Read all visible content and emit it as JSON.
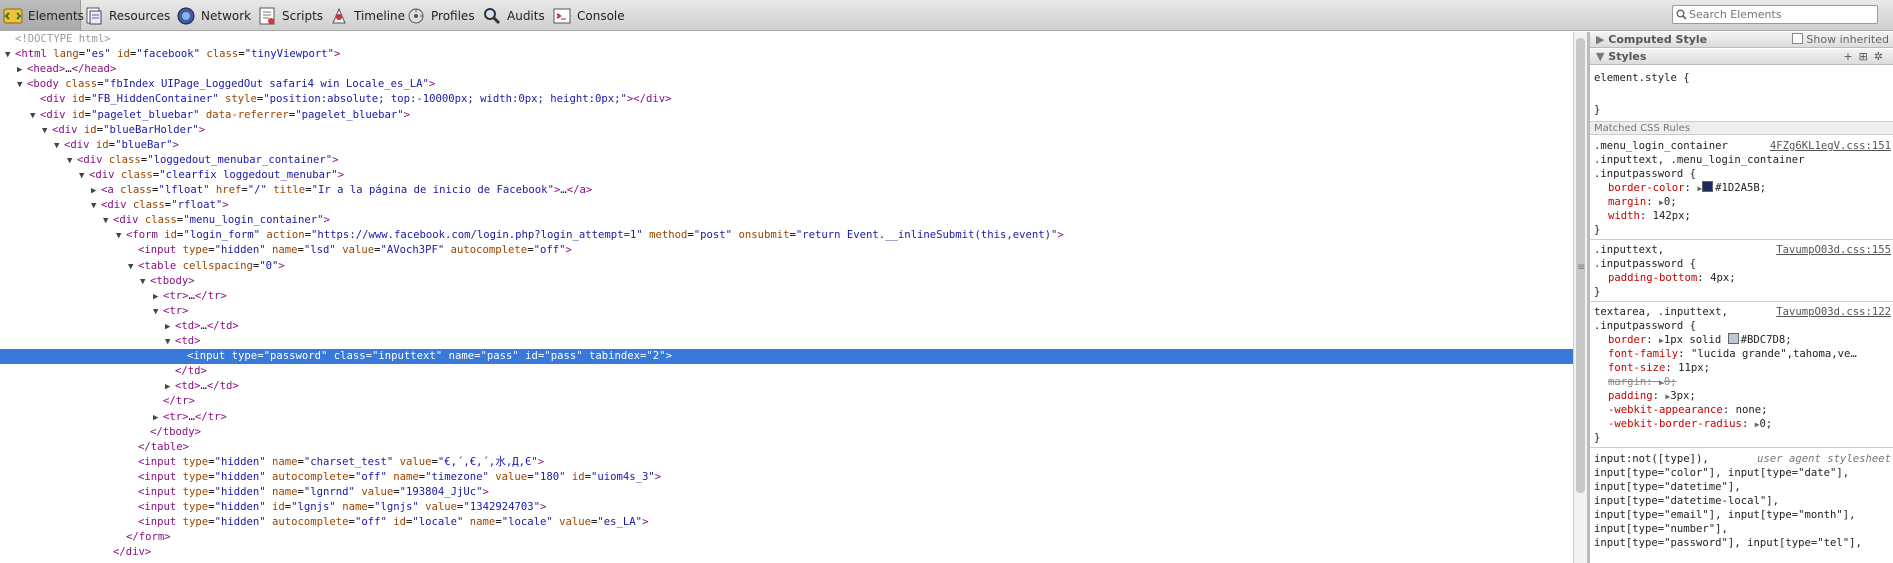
{
  "toolbar": {
    "tabs": [
      {
        "label": "Elements",
        "icon": "elements-icon"
      },
      {
        "label": "Resources",
        "icon": "resources-icon"
      },
      {
        "label": "Network",
        "icon": "network-icon"
      },
      {
        "label": "Scripts",
        "icon": "scripts-icon"
      },
      {
        "label": "Timeline",
        "icon": "timeline-icon"
      },
      {
        "label": "Profiles",
        "icon": "profiles-icon"
      },
      {
        "label": "Audits",
        "icon": "audits-icon"
      },
      {
        "label": "Console",
        "icon": "console-icon"
      }
    ],
    "search_placeholder": "Search Elements"
  },
  "dom": {
    "lines": [
      {
        "depth": 0,
        "tri": "",
        "html": "<span class=\"cm\">&lt;!DOCTYPE html&gt;</span>"
      },
      {
        "depth": 0,
        "tri": "▼",
        "html": "<span class=\"tag\">&lt;html</span> <span class=\"an\">lang</span>=<span class=\"av\">\"es\"</span> <span class=\"an\">id</span>=<span class=\"av\">\"facebook\"</span> <span class=\"an\">class</span>=<span class=\"av\">\"tinyViewport\"</span><span class=\"tag\">&gt;</span>"
      },
      {
        "depth": 1,
        "tri": "▶",
        "html": "<span class=\"tag\">&lt;head&gt;</span><span class=\"tx\">…</span><span class=\"tag\">&lt;/head&gt;</span>"
      },
      {
        "depth": 1,
        "tri": "▼",
        "html": "<span class=\"tag\">&lt;body</span> <span class=\"an\">class</span>=<span class=\"av\">\"fbIndex UIPage_LoggedOut safari4 win Locale_es_LA\"</span><span class=\"tag\">&gt;</span>"
      },
      {
        "depth": 2,
        "tri": "",
        "html": "<span class=\"tag\">&lt;div</span> <span class=\"an\">id</span>=<span class=\"av\">\"FB_HiddenContainer\"</span> <span class=\"an\">style</span>=<span class=\"av\">\"position:absolute; top:-10000px; width:0px; height:0px;\"</span><span class=\"tag\">&gt;&lt;/div&gt;</span>"
      },
      {
        "depth": 2,
        "tri": "▼",
        "html": "<span class=\"tag\">&lt;div</span> <span class=\"an\">id</span>=<span class=\"av\">\"pagelet_bluebar\"</span> <span class=\"an\">data-referrer</span>=<span class=\"av\">\"pagelet_bluebar\"</span><span class=\"tag\">&gt;</span>"
      },
      {
        "depth": 3,
        "tri": "▼",
        "html": "<span class=\"tag\">&lt;div</span> <span class=\"an\">id</span>=<span class=\"av\">\"blueBarHolder\"</span><span class=\"tag\">&gt;</span>"
      },
      {
        "depth": 4,
        "tri": "▼",
        "html": "<span class=\"tag\">&lt;div</span> <span class=\"an\">id</span>=<span class=\"av\">\"blueBar\"</span><span class=\"tag\">&gt;</span>"
      },
      {
        "depth": 5,
        "tri": "▼",
        "html": "<span class=\"tag\">&lt;div</span> <span class=\"an\">class</span>=<span class=\"av\">\"loggedout_menubar_container\"</span><span class=\"tag\">&gt;</span>"
      },
      {
        "depth": 6,
        "tri": "▼",
        "html": "<span class=\"tag\">&lt;div</span> <span class=\"an\">class</span>=<span class=\"av\">\"clearfix loggedout_menubar\"</span><span class=\"tag\">&gt;</span>"
      },
      {
        "depth": 7,
        "tri": "▶",
        "html": "<span class=\"tag\">&lt;a</span> <span class=\"an\">class</span>=<span class=\"av\">\"lfloat\"</span> <span class=\"an\">href</span>=<span class=\"av\">\"/\"</span> <span class=\"an\">title</span>=<span class=\"av\">\"Ir a la página de inicio de Facebook\"</span><span class=\"tag\">&gt;</span><span class=\"tx\">…</span><span class=\"tag\">&lt;/a&gt;</span>"
      },
      {
        "depth": 7,
        "tri": "▼",
        "html": "<span class=\"tag\">&lt;div</span> <span class=\"an\">class</span>=<span class=\"av\">\"rfloat\"</span><span class=\"tag\">&gt;</span>"
      },
      {
        "depth": 8,
        "tri": "▼",
        "html": "<span class=\"tag\">&lt;div</span> <span class=\"an\">class</span>=<span class=\"av\">\"menu_login_container\"</span><span class=\"tag\">&gt;</span>"
      },
      {
        "depth": 9,
        "tri": "▼",
        "html": "<span class=\"tag\">&lt;form</span> <span class=\"an\">id</span>=<span class=\"av\">\"login_form\"</span> <span class=\"an\">action</span>=<span class=\"av\">\"https://www.facebook.com/login.php?login_attempt=1\"</span> <span class=\"an\">method</span>=<span class=\"av\">\"post\"</span> <span class=\"an\">onsubmit</span>=<span class=\"av\">\"return Event.__inlineSubmit(this,event)\"</span><span class=\"tag\">&gt;</span>"
      },
      {
        "depth": 10,
        "tri": "",
        "html": "<span class=\"tag\">&lt;input</span> <span class=\"an\">type</span>=<span class=\"av\">\"hidden\"</span> <span class=\"an\">name</span>=<span class=\"av\">\"lsd\"</span> <span class=\"an\">value</span>=<span class=\"av\">\"AVoch3PF\"</span> <span class=\"an\">autocomplete</span>=<span class=\"av\">\"off\"</span><span class=\"tag\">&gt;</span>"
      },
      {
        "depth": 10,
        "tri": "▼",
        "html": "<span class=\"tag\">&lt;table</span> <span class=\"an\">cellspacing</span>=<span class=\"av\">\"0\"</span><span class=\"tag\">&gt;</span>"
      },
      {
        "depth": 11,
        "tri": "▼",
        "html": "<span class=\"tag\">&lt;tbody&gt;</span>"
      },
      {
        "depth": 12,
        "tri": "▶",
        "html": "<span class=\"tag\">&lt;tr&gt;</span><span class=\"tx\">…</span><span class=\"tag\">&lt;/tr&gt;</span>"
      },
      {
        "depth": 12,
        "tri": "▼",
        "html": "<span class=\"tag\">&lt;tr&gt;</span>"
      },
      {
        "depth": 13,
        "tri": "▶",
        "html": "<span class=\"tag\">&lt;td&gt;</span><span class=\"tx\">…</span><span class=\"tag\">&lt;/td&gt;</span>"
      },
      {
        "depth": 13,
        "tri": "▼",
        "html": "<span class=\"tag\">&lt;td&gt;</span>"
      },
      {
        "depth": 14,
        "tri": "",
        "sel": true,
        "html": "<span class=\"tag\">&lt;input</span> <span class=\"an\">type</span>=<span class=\"av\">\"password\"</span> <span class=\"an\">class</span>=<span class=\"av\">\"inputtext\"</span> <span class=\"an\">name</span>=<span class=\"av\">\"pass\"</span> <span class=\"an\">id</span>=<span class=\"av\">\"pass\"</span> <span class=\"an\">tabindex</span>=<span class=\"av\">\"2\"</span><span class=\"tag\">&gt;</span>"
      },
      {
        "depth": 13,
        "tri": "",
        "html": "<span class=\"tag\">&lt;/td&gt;</span>"
      },
      {
        "depth": 13,
        "tri": "▶",
        "html": "<span class=\"tag\">&lt;td&gt;</span><span class=\"tx\">…</span><span class=\"tag\">&lt;/td&gt;</span>"
      },
      {
        "depth": 12,
        "tri": "",
        "html": "<span class=\"tag\">&lt;/tr&gt;</span>"
      },
      {
        "depth": 12,
        "tri": "▶",
        "html": "<span class=\"tag\">&lt;tr&gt;</span><span class=\"tx\">…</span><span class=\"tag\">&lt;/tr&gt;</span>"
      },
      {
        "depth": 11,
        "tri": "",
        "html": "<span class=\"tag\">&lt;/tbody&gt;</span>"
      },
      {
        "depth": 10,
        "tri": "",
        "html": "<span class=\"tag\">&lt;/table&gt;</span>"
      },
      {
        "depth": 10,
        "tri": "",
        "html": "<span class=\"tag\">&lt;input</span> <span class=\"an\">type</span>=<span class=\"av\">\"hidden\"</span> <span class=\"an\">name</span>=<span class=\"av\">\"charset_test\"</span> <span class=\"an\">value</span>=<span class=\"av\">\"€,´,€,´,水,Д,Є\"</span><span class=\"tag\">&gt;</span>"
      },
      {
        "depth": 10,
        "tri": "",
        "html": "<span class=\"tag\">&lt;input</span> <span class=\"an\">type</span>=<span class=\"av\">\"hidden\"</span> <span class=\"an\">autocomplete</span>=<span class=\"av\">\"off\"</span> <span class=\"an\">name</span>=<span class=\"av\">\"timezone\"</span> <span class=\"an\">value</span>=<span class=\"av\">\"180\"</span> <span class=\"an\">id</span>=<span class=\"av\">\"uiom4s_3\"</span><span class=\"tag\">&gt;</span>"
      },
      {
        "depth": 10,
        "tri": "",
        "html": "<span class=\"tag\">&lt;input</span> <span class=\"an\">type</span>=<span class=\"av\">\"hidden\"</span> <span class=\"an\">name</span>=<span class=\"av\">\"lgnrnd\"</span> <span class=\"an\">value</span>=<span class=\"av\">\"193804_JjUc\"</span><span class=\"tag\">&gt;</span>"
      },
      {
        "depth": 10,
        "tri": "",
        "html": "<span class=\"tag\">&lt;input</span> <span class=\"an\">type</span>=<span class=\"av\">\"hidden\"</span> <span class=\"an\">id</span>=<span class=\"av\">\"lgnjs\"</span> <span class=\"an\">name</span>=<span class=\"av\">\"lgnjs\"</span> <span class=\"an\">value</span>=<span class=\"av\">\"1342924703\"</span><span class=\"tag\">&gt;</span>"
      },
      {
        "depth": 10,
        "tri": "",
        "html": "<span class=\"tag\">&lt;input</span> <span class=\"an\">type</span>=<span class=\"av\">\"hidden\"</span> <span class=\"an\">autocomplete</span>=<span class=\"av\">\"off\"</span> <span class=\"an\">id</span>=<span class=\"av\">\"locale\"</span> <span class=\"an\">name</span>=<span class=\"av\">\"locale\"</span> <span class=\"an\">value</span>=<span class=\"av\">\"es_LA\"</span><span class=\"tag\">&gt;</span>"
      },
      {
        "depth": 9,
        "tri": "",
        "html": "<span class=\"tag\">&lt;/form&gt;</span>"
      },
      {
        "depth": 8,
        "tri": "",
        "html": "<span class=\"tag\">&lt;/div&gt;</span>"
      }
    ]
  },
  "sidebar": {
    "computed_style": "Computed Style",
    "show_inherited": "Show inherited",
    "styles": "Styles",
    "element_style_open": "element.style {",
    "close_brace": "}",
    "matched_css_rules": "Matched CSS Rules",
    "rule1": {
      "sel1": ".menu_login_container",
      "sel2": ".inputtext, .menu_login_container",
      "sel3": ".inputpassword {",
      "source": "4FZg6KL1egV.css:151",
      "props": [
        {
          "name": "border-color",
          "value": "#1D2A5B;",
          "swatch": "#1D2A5B",
          "arrow": true
        },
        {
          "name": "margin",
          "value": "0;",
          "arrow": true
        },
        {
          "name": "width",
          "value": "142px;"
        }
      ]
    },
    "rule2": {
      "sel1": ".inputtext,",
      "sel2": ".inputpassword {",
      "source": "TavumpO03d.css:155",
      "props": [
        {
          "name": "padding-bottom",
          "value": "4px;"
        }
      ]
    },
    "rule3": {
      "sel1": "textarea, .inputtext,",
      "sel2": ".inputpassword {",
      "source": "TavumpO03d.css:122",
      "props": [
        {
          "name": "border",
          "value": "1px solid ",
          "swatch": "#BDC7D8",
          "value2": "#BDC7D8;",
          "arrow": true
        },
        {
          "name": "font-family",
          "value": "\"lucida grande\",tahoma,ve…"
        },
        {
          "name": "font-size",
          "value": "11px;"
        },
        {
          "name": "margin",
          "value": "0;",
          "arrow": true,
          "struck": true
        },
        {
          "name": "padding",
          "value": "3px;",
          "arrow": true
        },
        {
          "name": "-webkit-appearance",
          "value": "none;"
        },
        {
          "name": "-webkit-border-radius",
          "value": "0;",
          "arrow": true
        }
      ]
    },
    "rule4": {
      "lines": [
        "input:not([type]),",
        "input[type=\"color\"], input[type=\"date\"],",
        "input[type=\"datetime\"],",
        "input[type=\"datetime-local\"],",
        "input[type=\"email\"], input[type=\"month\"],",
        "input[type=\"number\"],",
        "input[type=\"password\"], input[type=\"tel\"],"
      ],
      "source": "user agent stylesheet"
    }
  }
}
